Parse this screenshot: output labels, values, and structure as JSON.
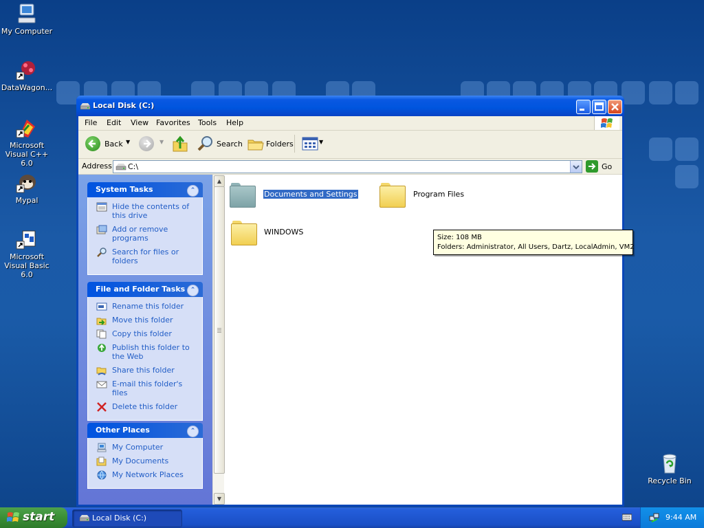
{
  "desktop": {
    "icons": [
      {
        "label": "My Computer",
        "icon": "my-computer-icon"
      },
      {
        "label": "DataWagon...",
        "icon": "datawagon-shortcut-icon"
      },
      {
        "label": "Microsoft Visual C++ 6.0",
        "icon": "visual-cpp-shortcut-icon"
      },
      {
        "label": "Mypal",
        "icon": "mypal-shortcut-icon"
      },
      {
        "label": "Microsoft Visual Basic 6.0",
        "icon": "visual-basic-shortcut-icon"
      },
      {
        "label": "Recycle Bin",
        "icon": "recycle-bin-icon"
      }
    ]
  },
  "window": {
    "title": "Local Disk (C:)",
    "menu": [
      "File",
      "Edit",
      "View",
      "Favorites",
      "Tools",
      "Help"
    ],
    "toolbar": {
      "back_label": "Back",
      "search_label": "Search",
      "folders_label": "Folders"
    },
    "address": {
      "label": "Address",
      "value": "C:\\",
      "go_label": "Go"
    },
    "task_pane": {
      "system_tasks": {
        "title": "System Tasks",
        "items": [
          {
            "label": "Hide the contents of this drive",
            "icon": "hide-contents-icon"
          },
          {
            "label": "Add or remove programs",
            "icon": "add-remove-programs-icon"
          },
          {
            "label": "Search for files or folders",
            "icon": "search-icon"
          }
        ]
      },
      "file_folder_tasks": {
        "title": "File and Folder Tasks",
        "items": [
          {
            "label": "Rename this folder",
            "icon": "rename-icon"
          },
          {
            "label": "Move this folder",
            "icon": "move-icon"
          },
          {
            "label": "Copy this folder",
            "icon": "copy-icon"
          },
          {
            "label": "Publish this folder to the Web",
            "icon": "publish-web-icon"
          },
          {
            "label": "Share this folder",
            "icon": "share-icon"
          },
          {
            "label": "E-mail this folder's files",
            "icon": "email-icon"
          },
          {
            "label": "Delete this folder",
            "icon": "delete-icon"
          }
        ]
      },
      "other_places": {
        "title": "Other Places",
        "items": [
          {
            "label": "My Computer",
            "icon": "my-computer-icon"
          },
          {
            "label": "My Documents",
            "icon": "my-documents-icon"
          },
          {
            "label": "My Network Places",
            "icon": "network-places-icon"
          }
        ]
      }
    },
    "files": [
      {
        "name": "Documents and Settings",
        "selected": true
      },
      {
        "name": "Program Files",
        "selected": false
      },
      {
        "name": "WINDOWS",
        "selected": false
      }
    ],
    "tooltip": {
      "size": "Size: 108 MB",
      "folders": "Folders: Administrator, All Users, Dartz, LocalAdmin, VM2"
    }
  },
  "taskbar": {
    "start_label": "start",
    "window_button": "Local Disk (C:)",
    "clock": "9:44 AM"
  },
  "colors": {
    "xp_blue": "#0055de",
    "start_green": "#3a8f36",
    "link_blue": "#215dc6",
    "selection": "#316ac5",
    "tooltip_bg": "#ffffe1"
  }
}
